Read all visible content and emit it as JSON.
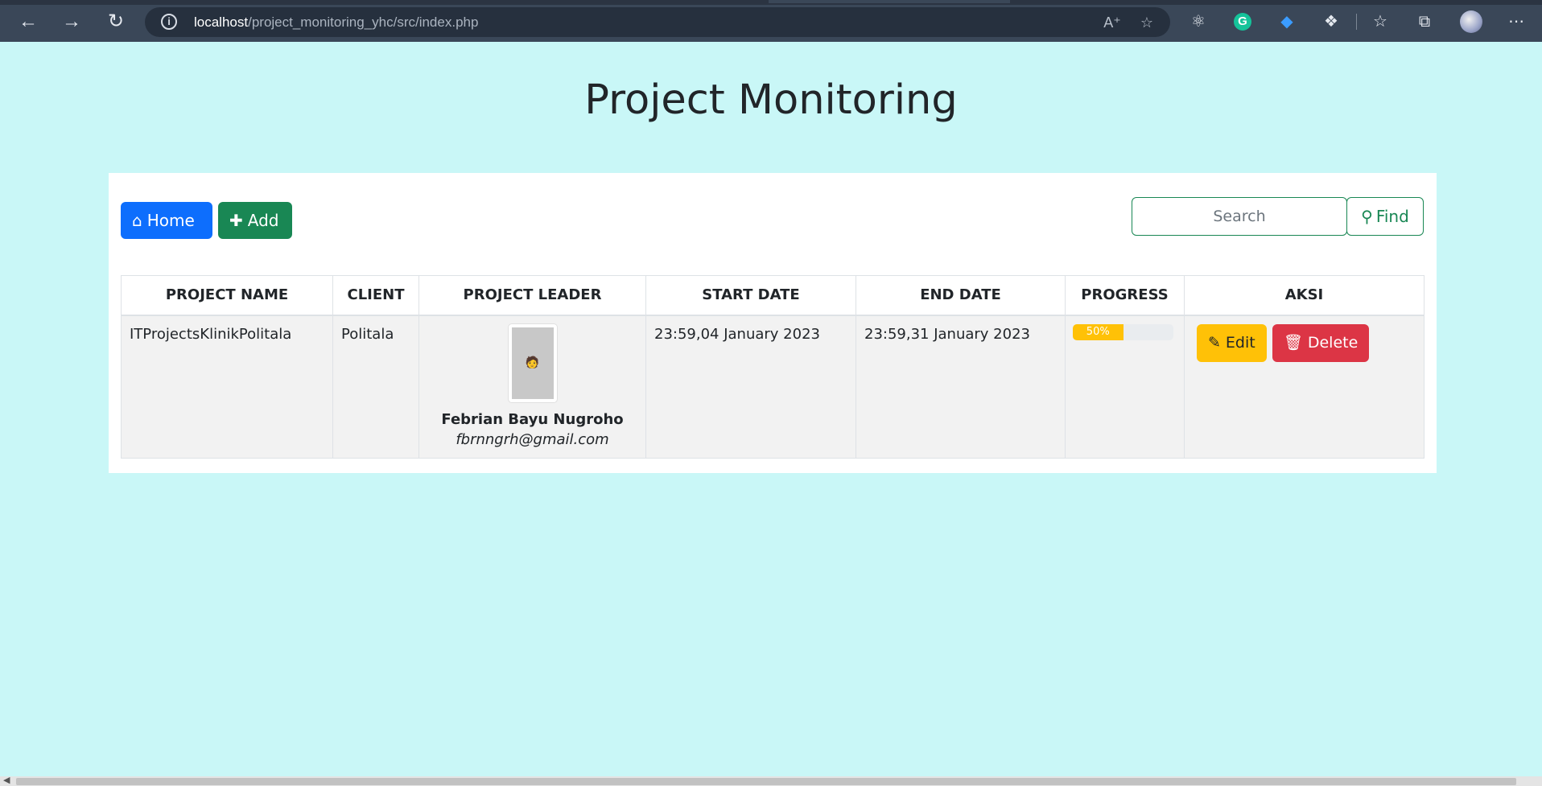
{
  "browser": {
    "url_host": "localhost",
    "url_path": "/project_monitoring_yhc/src/index.php",
    "icons": [
      "back-icon",
      "forward-icon",
      "refresh-icon",
      "info-icon",
      "read-aloud-icon",
      "favorite-add-icon",
      "react-devtools-icon",
      "grammarly-icon",
      "drop-extension-icon",
      "extensions-icon",
      "favorites-icon",
      "collections-icon",
      "profile-avatar",
      "more-icon"
    ],
    "grammarly_letter": "G"
  },
  "page": {
    "title": "Project Monitoring"
  },
  "toolbar": {
    "home_label": "Home",
    "add_label": "Add",
    "search_placeholder": "Search",
    "find_label": "Find"
  },
  "table": {
    "headers": [
      "PROJECT NAME",
      "CLIENT",
      "PROJECT LEADER",
      "START DATE",
      "END DATE",
      "PROGRESS",
      "AKSI"
    ],
    "rows": [
      {
        "project_name": "ITProjectsKlinikPolitala",
        "client": "Politala",
        "leader_name": "Febrian Bayu Nugroho",
        "leader_email": "fbrnngrh@gmail.com",
        "start_date": "23:59,04 January 2023",
        "end_date": "23:59,31 January 2023",
        "progress_label": "50%",
        "progress_value": 50,
        "edit_label": "Edit",
        "delete_label": "Delete"
      }
    ]
  },
  "colors": {
    "page_bg": "#c9f7f7",
    "primary": "#0d6efd",
    "success": "#198754",
    "warning": "#ffc107",
    "danger": "#dc3545"
  }
}
